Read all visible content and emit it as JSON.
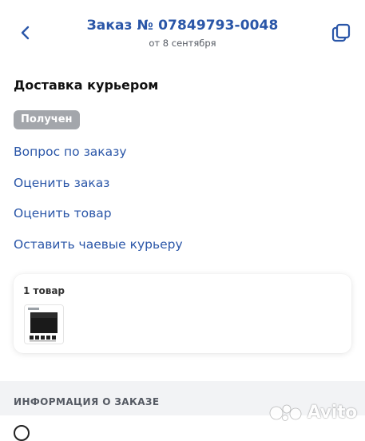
{
  "header": {
    "title": "Заказ № 07849793-0048",
    "date": "от 8 сентября",
    "back_icon": "chevron-left-icon",
    "copy_icon": "copy-icon"
  },
  "delivery": {
    "title": "Доставка курьером",
    "status": "Получен"
  },
  "actions": [
    {
      "label": "Вопрос по заказу"
    },
    {
      "label": "Оценить заказ"
    },
    {
      "label": "Оценить товар"
    },
    {
      "label": "Оставить чаевые курьеру"
    }
  ],
  "items_card": {
    "count_label": "1 товар",
    "product_image": "cooktop-product-image"
  },
  "info": {
    "title": "ИНФОРМАЦИЯ О ЗАКАЗЕ"
  },
  "watermark": {
    "text": "Avito"
  },
  "colors": {
    "accent": "#2a56a8",
    "badge_bg": "#a3a6ab",
    "section_bg": "#f2f3f5"
  }
}
